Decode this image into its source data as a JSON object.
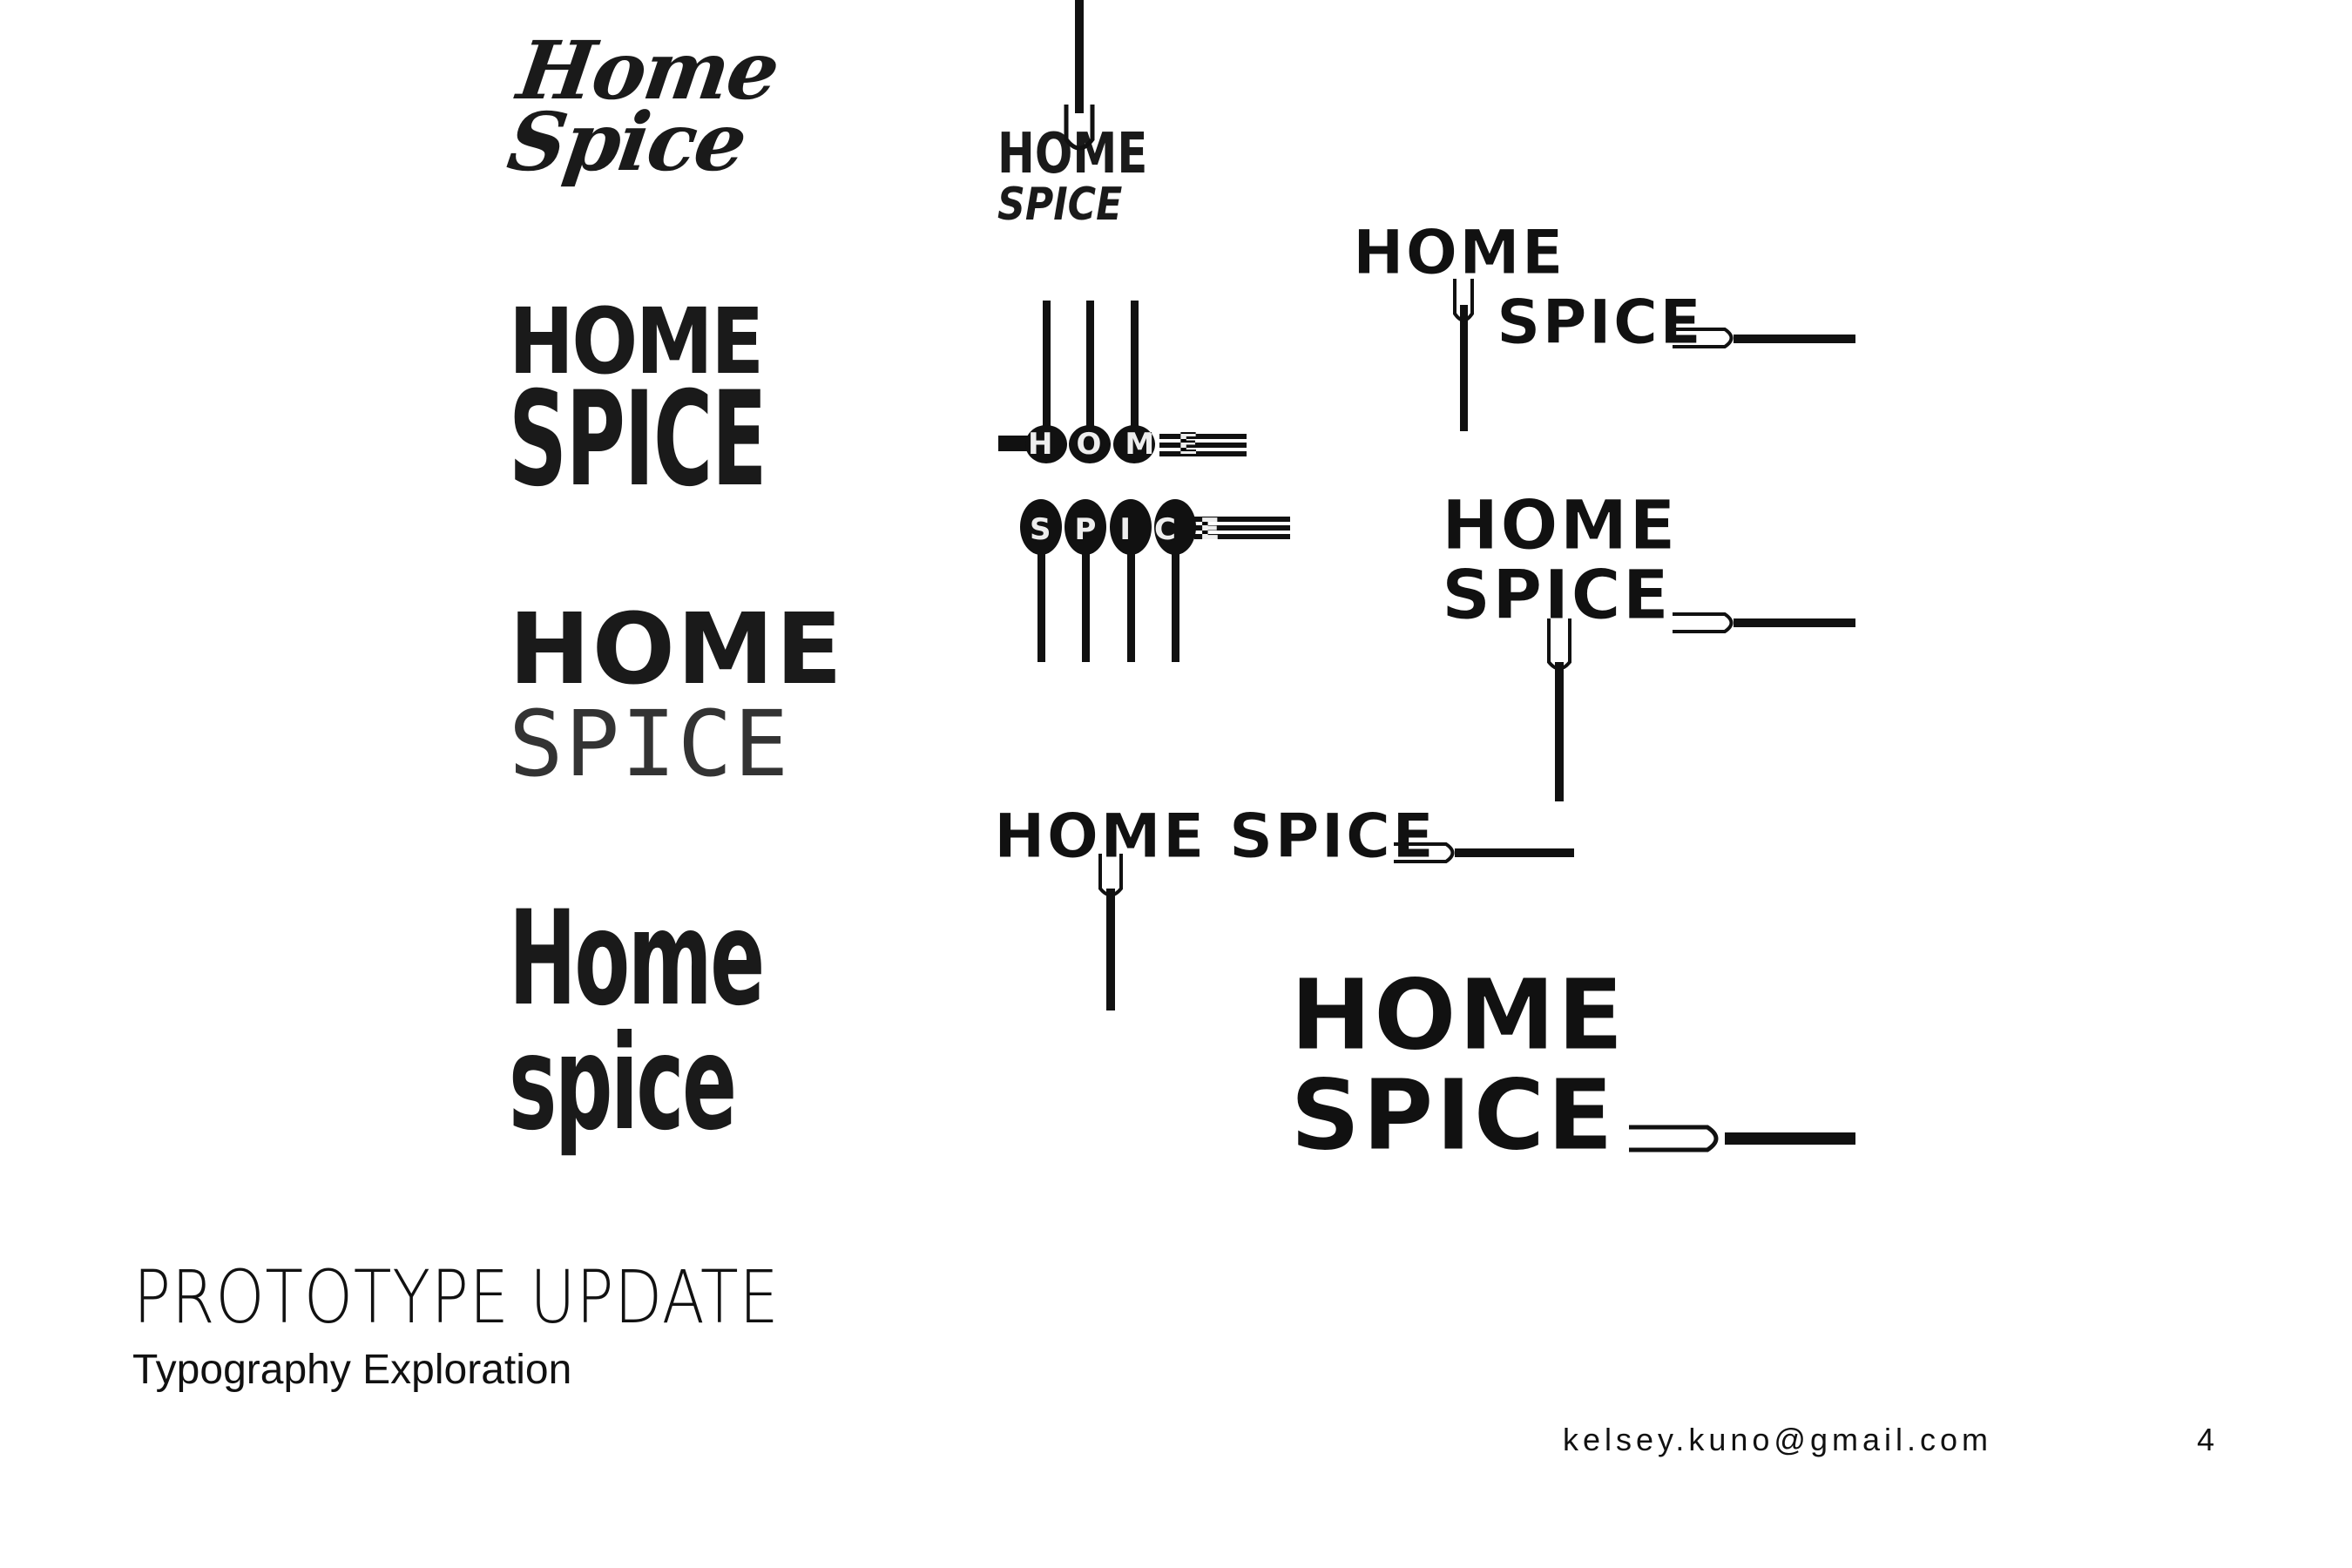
{
  "slide": {
    "title": "PROTOTYPE UPDATE",
    "subtitle": "Typography Exploration",
    "email": "kelsey.kuno@gmail.com",
    "page_number": "4"
  },
  "logos": {
    "script": {
      "line1": "Home",
      "line2": "Spice"
    },
    "bold_block": {
      "line1": "HOME",
      "line2": "SPICE"
    },
    "dotted": {
      "line1": "HOME",
      "line2": "SPICE"
    },
    "condensed": {
      "line1": "Home",
      "line2": "spice"
    },
    "fork_small": {
      "line1": "HOME",
      "line2": "SPICE"
    },
    "spoons": {
      "line1": "HOME",
      "line2": "SPICE"
    },
    "fork_stair": {
      "line1": "HOME",
      "line2": "SPICE"
    },
    "fork_stacked": {
      "line1": "HOME",
      "line2": "SPICE"
    },
    "fork_inline": {
      "line1": "HOME SPICE"
    },
    "outlined_large": {
      "line1": "HOME",
      "line2": "SPICE"
    }
  }
}
